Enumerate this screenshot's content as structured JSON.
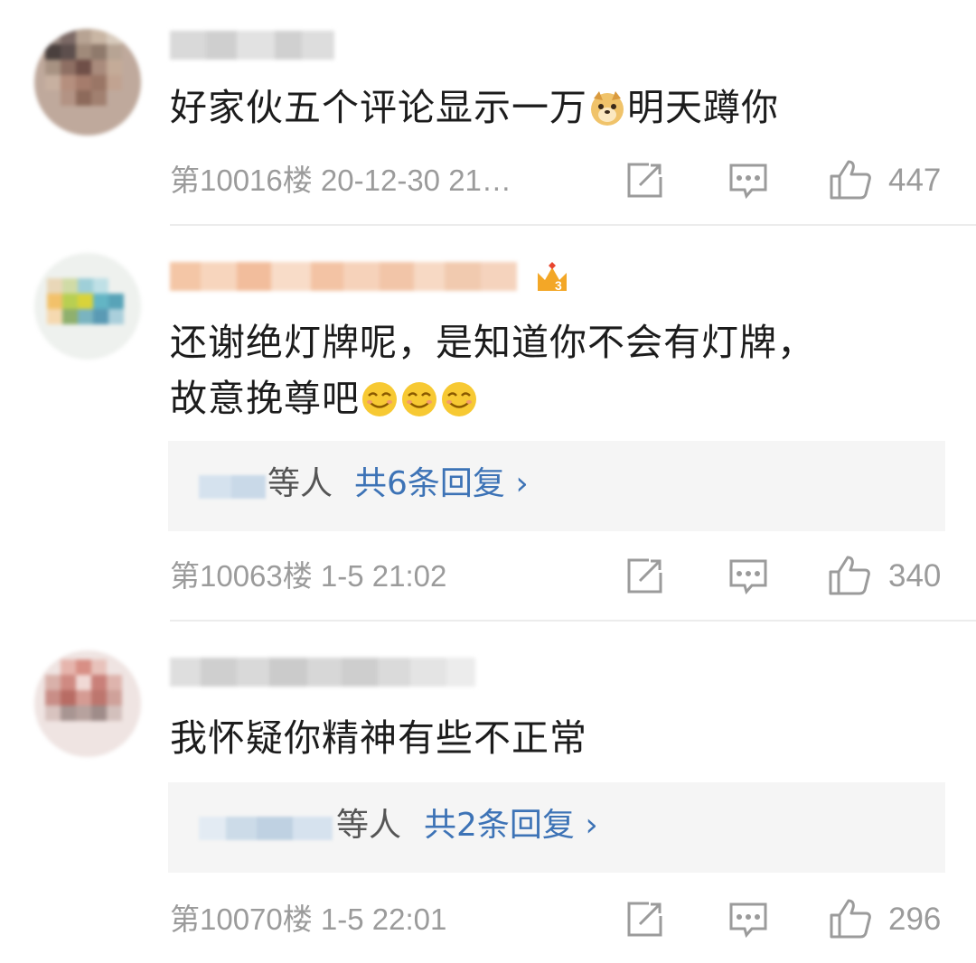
{
  "comments": [
    {
      "text": "好家伙五个评论显示一万",
      "text_after_emoji": "明天蹲你",
      "emoji": "doge-emoji",
      "floor_time": "第10016楼 20-12-30 21…",
      "likes": "447"
    },
    {
      "text": "还谢绝灯牌呢，是知道你不会有灯牌，\n故意挽尊吧",
      "emoji": "smile-emoji",
      "reply_suffix": "等人",
      "reply_count": "共6条回复 ›",
      "floor_time": "第10063楼 1-5 21:02",
      "likes": "340"
    },
    {
      "text": "我怀疑你精神有些不正常",
      "reply_suffix": "等人",
      "reply_count": "共2条回复 ›",
      "floor_time": "第10070楼 1-5 22:01",
      "likes": "296"
    }
  ],
  "icons": {
    "repost": "repost-icon",
    "comment": "comment-icon",
    "like": "thumbs-up-icon",
    "vip": "vip-crown-icon"
  },
  "colors": {
    "link": "#3d73b6",
    "meta": "#9b9b9b",
    "reply_bg": "#f5f5f5"
  }
}
